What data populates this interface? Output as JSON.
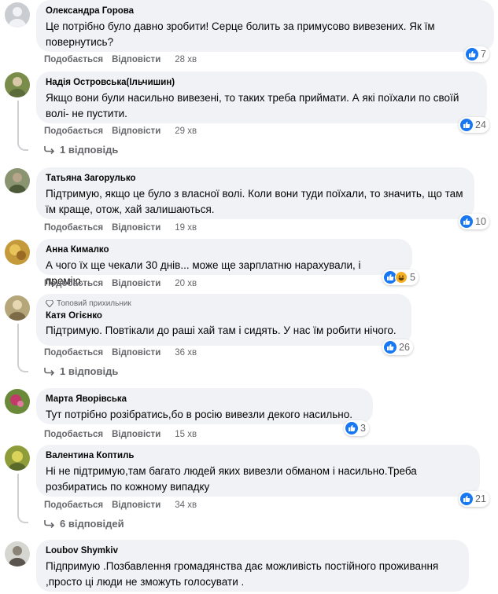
{
  "comments": [
    {
      "author": "Олександра Горова",
      "text": "Це потрібно було давно зробити! Серце болить за примусово вивезених. Як їм повернутись?",
      "like_label": "Подобається",
      "reply_label": "Відповісти",
      "time": "28 хв",
      "reactions": "7"
    },
    {
      "author": "Надія Островська(Ільчишин)",
      "text": "Якщо вони були насильно вивезені, то таких треба приймати. А які поїхали по своїй волі- не пустити.",
      "like_label": "Подобається",
      "reply_label": "Відповісти",
      "time": "29 хв",
      "reactions": "24",
      "replies": "1 відповідь"
    },
    {
      "author": "Татьяна Загорулько",
      "text": "Підтримую, якщо це було з власної волі. Коли вони туди поїхали, то значить, що там їм краще, отож, хай залишаються.",
      "like_label": "Подобається",
      "reply_label": "Відповісти",
      "time": "19 хв",
      "reactions": "10"
    },
    {
      "author": "Анна Кималко",
      "text": "А чого їх ще чекали 30 днів... може ще зарплатню нарахували, і премію...",
      "like_label": "Подобається",
      "reply_label": "Відповісти",
      "time": "20 хв",
      "reactions": "5"
    },
    {
      "badge": "Топовий прихильник",
      "author": "Катя Огієнко",
      "text": "Підтримую. Повтікали до раші хай там і сидять. У нас їм робити нічого.",
      "like_label": "Подобається",
      "reply_label": "Відповісти",
      "time": "36 хв",
      "reactions": "26",
      "replies": "1 відповідь"
    },
    {
      "author": "Марта Яворівська",
      "text": "Тут потрібно розібратись,бо в росію вивезли декого насильно.",
      "like_label": "Подобається",
      "reply_label": "Відповісти",
      "time": "15 хв",
      "reactions": "3"
    },
    {
      "author": "Валентина Коптиль",
      "text": "Ні не підтримую,там багато людей яких вивезли обманом і насильно.Треба розбиратись по кожному випадку",
      "like_label": "Подобається",
      "reply_label": "Відповісти",
      "time": "34 хв",
      "reactions": "21",
      "replies": "6 відповідей"
    },
    {
      "author": "Loubov Shymkiv",
      "text": "Підпримую .Позбавлення громадянства дає можливість постійного проживання ,просто ці люди не зможуть голосувати ."
    }
  ],
  "colors": {
    "bubble": "#f0f2f5",
    "like_blue": "#1877f2",
    "secondary_text": "#65676b",
    "thread_line": "#ced0d4"
  }
}
